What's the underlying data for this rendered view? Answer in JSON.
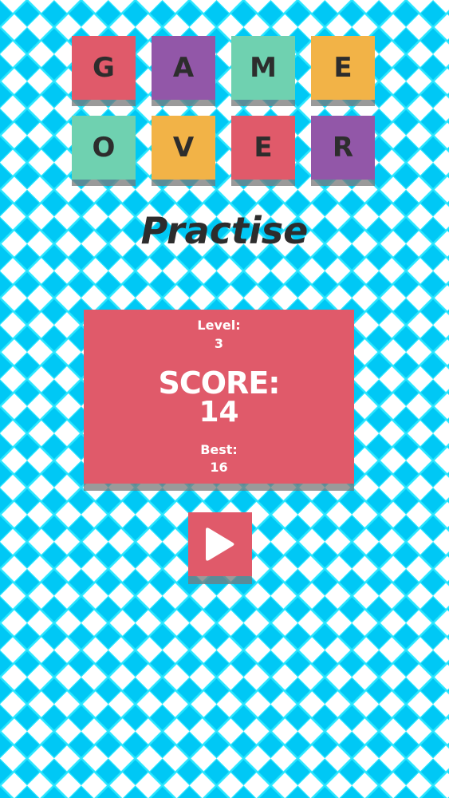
{
  "game_over_title": {
    "tiles": [
      {
        "letter": "G",
        "color": "#e05a6a"
      },
      {
        "letter": "A",
        "color": "#9257a8"
      },
      {
        "letter": "M",
        "color": "#6fd1b0"
      },
      {
        "letter": "E",
        "color": "#f2b347"
      },
      {
        "letter": "O",
        "color": "#6fd1b0"
      },
      {
        "letter": "V",
        "color": "#f2b347"
      },
      {
        "letter": "E",
        "color": "#e05a6a"
      },
      {
        "letter": "R",
        "color": "#9257a8"
      }
    ]
  },
  "mode": "Practise",
  "score_panel": {
    "level_label": "Level:",
    "level_value": "3",
    "score_label": "SCORE:",
    "score_value": "14",
    "best_label": "Best:",
    "best_value": "16",
    "color": "#e05a6a"
  },
  "play_button": {
    "icon": "play-icon",
    "color": "#e05a6a"
  },
  "background": {
    "pattern": "diagonal-checker",
    "colors": [
      "#00c8f5",
      "#ffffff"
    ]
  }
}
